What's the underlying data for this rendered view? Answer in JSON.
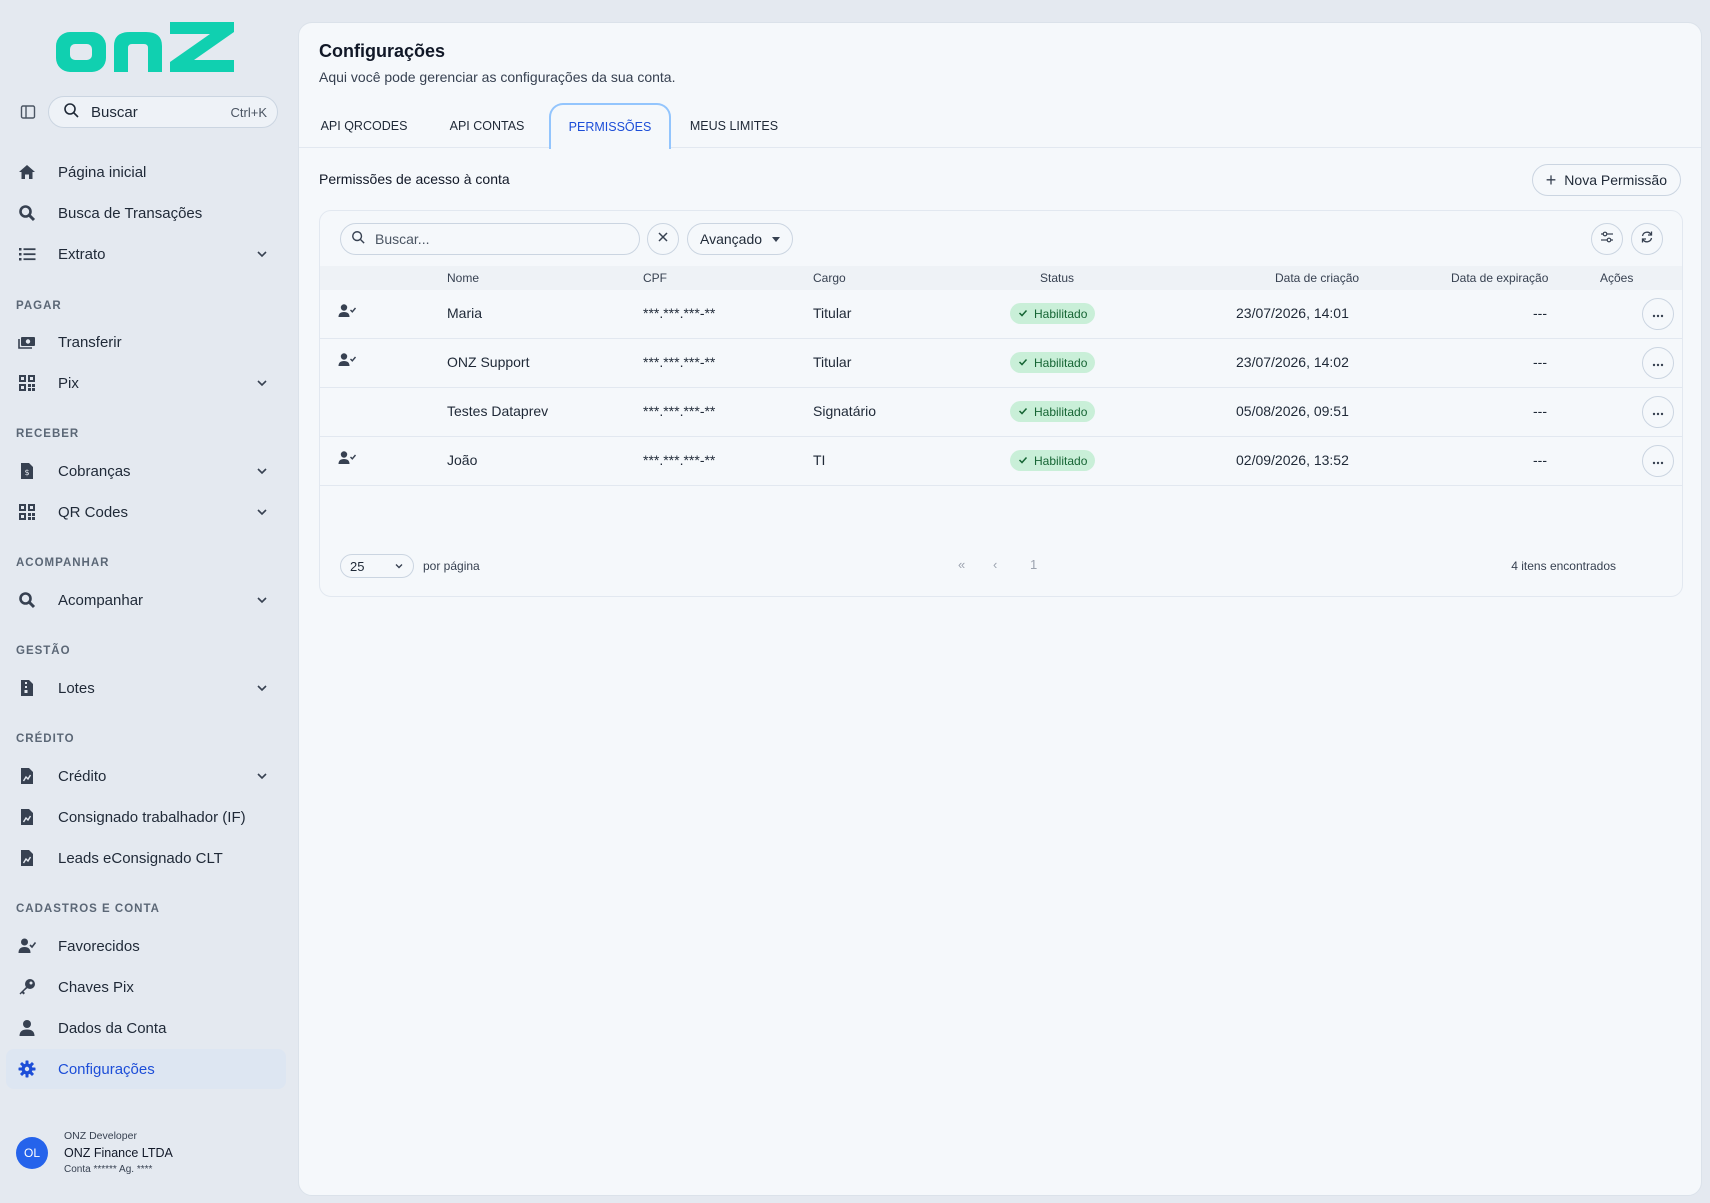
{
  "brand": {
    "logo_text": "onz",
    "accent": "#10d0b0"
  },
  "sidebar": {
    "search_label": "Buscar",
    "search_shortcut": "Ctrl+K",
    "top_items": [
      {
        "label": "Página inicial",
        "icon": "home-icon"
      },
      {
        "label": "Busca de Transações",
        "icon": "search-icon"
      },
      {
        "label": "Extrato",
        "icon": "list-icon",
        "expandable": true
      }
    ],
    "sections": [
      {
        "title": "PAGAR",
        "items": [
          {
            "label": "Transferir",
            "icon": "money-transfer-icon"
          },
          {
            "label": "Pix",
            "icon": "qr-icon",
            "expandable": true
          }
        ]
      },
      {
        "title": "RECEBER",
        "items": [
          {
            "label": "Cobranças",
            "icon": "invoice-icon",
            "expandable": true
          },
          {
            "label": "QR Codes",
            "icon": "qr-icon",
            "expandable": true
          }
        ]
      },
      {
        "title": "ACOMPANHAR",
        "items": [
          {
            "label": "Acompanhar",
            "icon": "search-icon",
            "expandable": true
          }
        ]
      },
      {
        "title": "GESTÃO",
        "items": [
          {
            "label": "Lotes",
            "icon": "file-zip-icon",
            "expandable": true
          }
        ]
      },
      {
        "title": "CRÉDITO",
        "items": [
          {
            "label": "Crédito",
            "icon": "document-chart-icon",
            "expandable": true
          },
          {
            "label": "Consignado trabalhador (IF)",
            "icon": "document-chart-icon"
          },
          {
            "label": "Leads eConsignado CLT",
            "icon": "document-chart-icon"
          }
        ]
      },
      {
        "title": "CADASTROS E CONTA",
        "items": [
          {
            "label": "Favorecidos",
            "icon": "user-check-icon"
          },
          {
            "label": "Chaves Pix",
            "icon": "key-icon"
          },
          {
            "label": "Dados da Conta",
            "icon": "user-icon"
          },
          {
            "label": "Configurações",
            "icon": "gear-icon",
            "active": true
          }
        ]
      }
    ],
    "user": {
      "initials": "OL",
      "role": "ONZ Developer",
      "company": "ONZ Finance LTDA",
      "account": "Conta ****** Ag. ****"
    }
  },
  "page": {
    "title": "Configurações",
    "subtitle": "Aqui você pode gerenciar as configurações da sua conta.",
    "tabs": [
      "API QRCODES",
      "API CONTAS",
      "PERMISSÕES",
      "MEUS LIMITES"
    ],
    "active_tab": "PERMISSÕES",
    "section_title": "Permissões de acesso à conta",
    "new_button": "Nova Permissão"
  },
  "table": {
    "search_placeholder": "Buscar...",
    "advanced_label": "Avançado",
    "columns": [
      "Nome",
      "CPF",
      "Cargo",
      "Status",
      "Data de criação",
      "Data de expiração",
      "Ações"
    ],
    "rows": [
      {
        "icon": true,
        "nome": "Maria",
        "cpf": "***.***.***-**",
        "cargo": "Titular",
        "status": "Habilitado",
        "criacao": "23/07/2026, 14:01",
        "expiracao": "---"
      },
      {
        "icon": true,
        "nome": "ONZ Support",
        "cpf": "***.***.***-**",
        "cargo": "Titular",
        "status": "Habilitado",
        "criacao": "23/07/2026, 14:02",
        "expiracao": "---"
      },
      {
        "icon": false,
        "nome": "Testes Dataprev",
        "cpf": "***.***.***-**",
        "cargo": "Signatário",
        "status": "Habilitado",
        "criacao": "05/08/2026, 09:51",
        "expiracao": "---"
      },
      {
        "icon": true,
        "nome": "João",
        "cpf": "***.***.***-**",
        "cargo": "TI",
        "status": "Habilitado",
        "criacao": "02/09/2026, 13:52",
        "expiracao": "---"
      }
    ],
    "page_size": "25",
    "per_page_label": "por página",
    "current_page": "1",
    "found_label": "4 itens encontrados"
  }
}
